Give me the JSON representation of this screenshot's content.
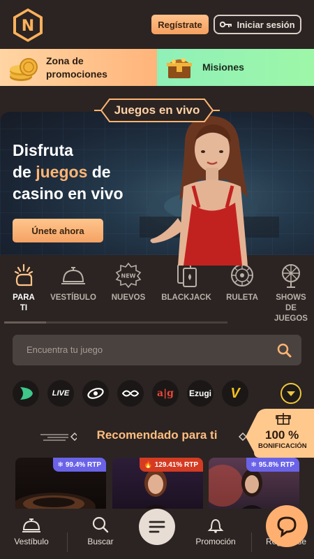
{
  "header": {
    "register_label": "Regístrate",
    "login_label": "Iniciar sesión"
  },
  "promo": {
    "left_label_line1": "Zona de",
    "left_label_line2": "promociones",
    "right_label": "Misiones"
  },
  "hero": {
    "tag": "Juegos en vivo",
    "title_line1": "Disfruta",
    "title_line2_a": "de ",
    "title_line2_hl": "juegos",
    "title_line2_b": " de",
    "title_line3": "casino en vivo",
    "cta": "Únete ahora",
    "accent": "#ffb574"
  },
  "categories": [
    {
      "label": "PARA TI",
      "line1": "PARA",
      "line2": "TI",
      "active": true
    },
    {
      "label": "VESTÍBULO",
      "line1": "VESTÍBULO",
      "line2": ""
    },
    {
      "label": "NUEVOS",
      "line1": "NUEVOS",
      "line2": "",
      "icon_text": "NEW"
    },
    {
      "label": "BLACKJACK",
      "line1": "BLACKJACK",
      "line2": ""
    },
    {
      "label": "RULETA",
      "line1": "RULETA",
      "line2": ""
    },
    {
      "label": "SHOWS DE JUEGOS",
      "line1": "SHOWS",
      "line2": "DE",
      "line3": "JUEGOS"
    }
  ],
  "search": {
    "placeholder": "Encuentra tu juego"
  },
  "providers": [
    {
      "name": "pragmatic-play-live",
      "text": ""
    },
    {
      "name": "live88",
      "text": "LIVE"
    },
    {
      "name": "provider-3",
      "text": ""
    },
    {
      "name": "provider-4",
      "text": ""
    },
    {
      "name": "absolute-live-gaming",
      "text": "a|g"
    },
    {
      "name": "ezugi",
      "text": "Ezugi"
    },
    {
      "name": "vivo-gaming",
      "text": "V"
    }
  ],
  "recommended": {
    "title": "Recomendado para ti",
    "games": [
      {
        "rtp": "99.4% RTP",
        "rtp_color": "#6a63e8"
      },
      {
        "rtp": "129.41% RTP",
        "rtp_color": "#d43b22"
      },
      {
        "rtp": "95.8% RTP",
        "rtp_color": "#6a63e8"
      }
    ]
  },
  "bonus": {
    "value": "100 %",
    "label": "BONIFICACIÓN"
  },
  "bottom_nav": {
    "lobby": "Vestíbulo",
    "search": "Buscar",
    "promo": "Promoción",
    "register": "Regístrese"
  }
}
